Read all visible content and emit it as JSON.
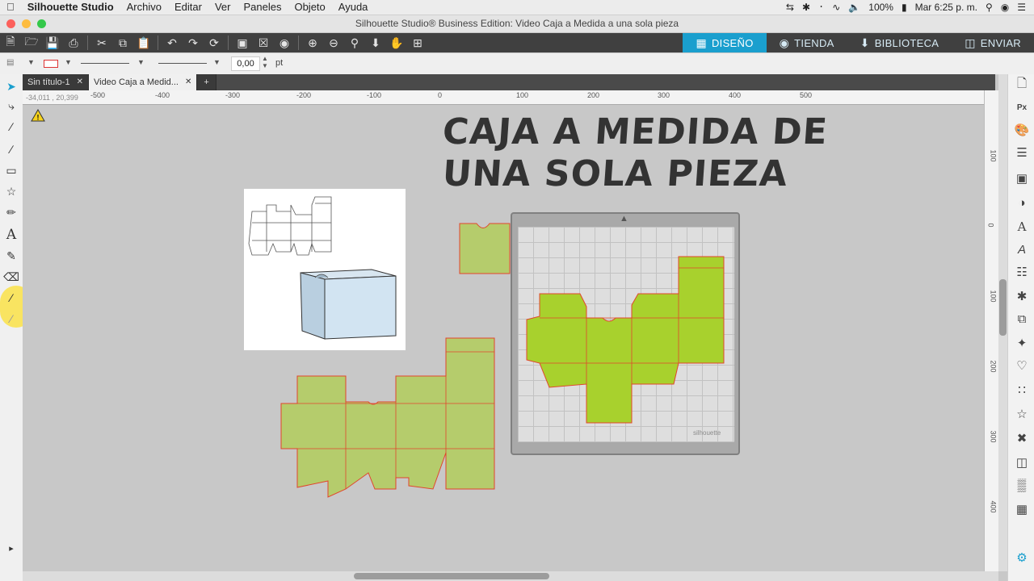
{
  "menubar": {
    "app_name": "Silhouette Studio",
    "items": [
      "Archivo",
      "Editar",
      "Ver",
      "Paneles",
      "Objeto",
      "Ayuda"
    ],
    "battery": "100%",
    "clock": "Mar 6:25 p. m."
  },
  "window": {
    "title": "Silhouette Studio® Business Edition: Video Caja a Medida a una sola pieza"
  },
  "nav_tabs": [
    {
      "label": "DISEÑO",
      "icon": "grid-icon",
      "active": true
    },
    {
      "label": "TIENDA",
      "icon": "s-logo-icon",
      "active": false
    },
    {
      "label": "BIBLIOTECA",
      "icon": "download-icon",
      "active": false
    },
    {
      "label": "ENVIAR",
      "icon": "cutter-icon",
      "active": false
    }
  ],
  "options": {
    "line_width_value": "0,00",
    "line_width_unit": "pt"
  },
  "doc_tabs": [
    {
      "label": "Sin título-1",
      "active": false
    },
    {
      "label": "Video Caja a Medid...",
      "active": true
    }
  ],
  "coords": "-34,011 , 20,399",
  "hruler_labels": [
    "-500",
    "-400",
    "-300",
    "-200",
    "-100",
    "0",
    "100",
    "200",
    "300",
    "400",
    "500"
  ],
  "vruler_labels": [
    "100",
    "0",
    "100",
    "200",
    "300",
    "400"
  ],
  "canvas": {
    "heading_line1": "CAJA A MEDIDA DE",
    "heading_line2": "UNA SOLA PIEZA",
    "mat_brand": "silhouette"
  },
  "colors": {
    "accent": "#1a9fce",
    "shape_fill": "#b5cc6c",
    "shape_stroke": "#e2452b",
    "mat_shape_fill": "#a8d12d",
    "toolbar_bg": "#404040"
  }
}
